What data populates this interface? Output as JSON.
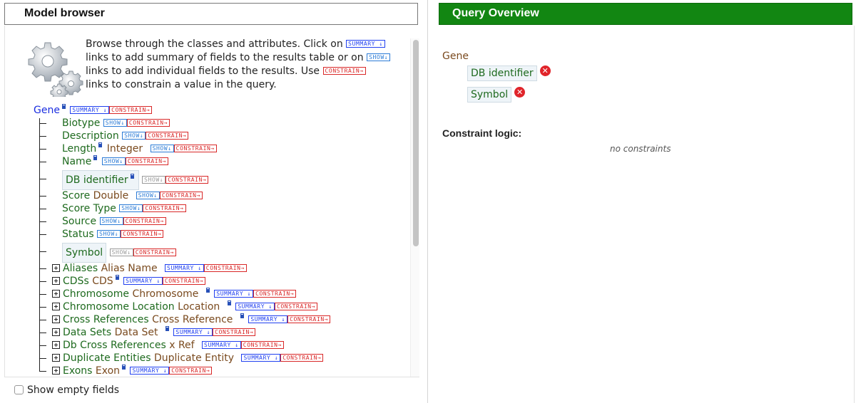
{
  "model_browser": {
    "title": "Model browser",
    "intro": {
      "t1": "Browse through the classes and attributes. Click on",
      "t2": "links to add summary of fields to the results table or on",
      "t3": "links to add individual fields to the results. Use",
      "t4": "links to constrain a value in the query."
    },
    "tags": {
      "summary": "SUMMARY ↓",
      "show": "SHOW↓",
      "constrain": "CONSTRAIN→"
    },
    "root": {
      "label": "Gene"
    },
    "attributes": [
      {
        "name": "Biotype",
        "type": ""
      },
      {
        "name": "Description",
        "type": ""
      },
      {
        "name": "Length",
        "type": "Integer"
      },
      {
        "name": "Name",
        "type": ""
      },
      {
        "name": "DB identifier",
        "type": ""
      },
      {
        "name": "Score",
        "type": "Double"
      },
      {
        "name": "Score Type",
        "type": ""
      },
      {
        "name": "Source",
        "type": ""
      },
      {
        "name": "Status",
        "type": ""
      },
      {
        "name": "Symbol",
        "type": ""
      }
    ],
    "references": [
      {
        "name": "Aliases",
        "type": "Alias Name"
      },
      {
        "name": "CDSs",
        "type": "CDS"
      },
      {
        "name": "Chromosome",
        "type": "Chromosome"
      },
      {
        "name": "Chromosome Location",
        "type": "Location"
      },
      {
        "name": "Cross References",
        "type": "Cross Reference"
      },
      {
        "name": "Data Sets",
        "type": "Data Set"
      },
      {
        "name": "Db Cross References",
        "type": "x Ref"
      },
      {
        "name": "Duplicate Entities",
        "type": "Duplicate Entity"
      },
      {
        "name": "Exons",
        "type": "Exon"
      }
    ],
    "show_empty_fields": "Show empty fields"
  },
  "query_overview": {
    "title": "Query Overview",
    "class": "Gene",
    "fields": [
      "DB identifier",
      "Symbol"
    ],
    "constraint_logic_label": "Constraint logic:",
    "constraint_logic_value": "no constraints"
  },
  "colors": {
    "header_green": "#128612",
    "link_blue": "#1b2ee0",
    "attr_green": "#1e6a1e",
    "type_brown": "#7a4a1e",
    "remove_red": "#e0242a"
  }
}
